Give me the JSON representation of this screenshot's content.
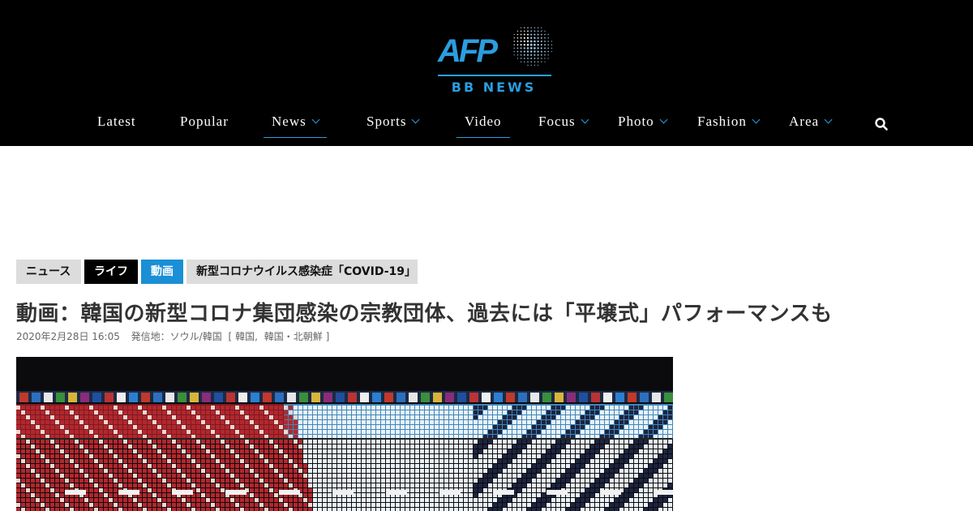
{
  "header": {
    "logo_text": "AFP",
    "logo_subtitle": "BB NEWS"
  },
  "nav": {
    "items": [
      {
        "label": "Latest",
        "has_dropdown": false
      },
      {
        "label": "Popular",
        "has_dropdown": false
      },
      {
        "label": "News",
        "has_dropdown": true
      },
      {
        "label": "Sports",
        "has_dropdown": true
      },
      {
        "label": "Video",
        "has_dropdown": false
      },
      {
        "label": "Focus",
        "has_dropdown": true
      },
      {
        "label": "Photo",
        "has_dropdown": true
      },
      {
        "label": "Fashion",
        "has_dropdown": true
      },
      {
        "label": "Area",
        "has_dropdown": true
      }
    ],
    "search_icon": "search-icon",
    "accent_color": "#2a9ee0"
  },
  "tags": [
    {
      "label": "ニュース",
      "style": "grey"
    },
    {
      "label": "ライフ",
      "style": "black"
    },
    {
      "label": "動画",
      "style": "blue"
    },
    {
      "label": "新型コロナウイルス感染症「COVID-19」",
      "style": "grey"
    }
  ],
  "article": {
    "headline": "動画：韓国の新型コロナ集団感染の宗教団体、過去には「平壌式」パフォーマンスも",
    "date": "2020年2月28日 16:05",
    "location": "発信地：ソウル/韓国",
    "region_open": "[",
    "region_1": "韓国",
    "region_sep": ",",
    "region_2": "韓国・北朝鮮",
    "region_close": "]"
  },
  "photo": {
    "description_icon": "stadium-mass-games-photo"
  }
}
